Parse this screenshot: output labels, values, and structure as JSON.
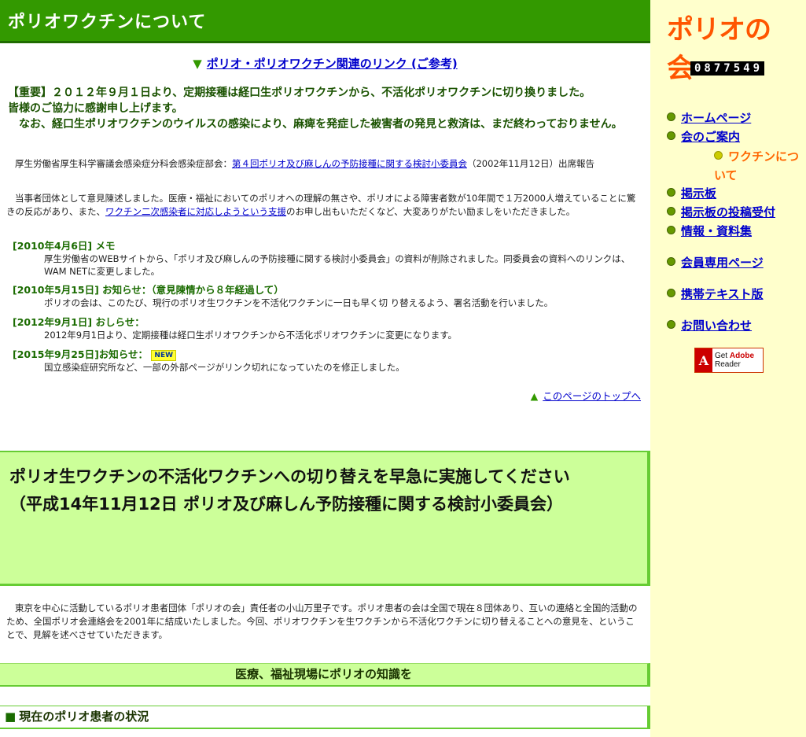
{
  "page_title": "ポリオワクチンについて",
  "ref_link": {
    "arrow": "▼",
    "label": "ポリオ・ポリオワクチン関連のリンク (ご参考)"
  },
  "important": {
    "line1": "【重要】２０１２年９月１日より、定期接種は経口生ポリオワクチンから、不活化ポリオワクチンに切り換りました。",
    "line2": "皆様のご協力に感謝申し上げます。",
    "line3": "　なお、経口生ポリオワクチンのウイルスの感染により、麻痺を発症した被害者の発見と救済は、まだ終わっておりません。"
  },
  "report": {
    "prefix": "厚生労働省厚生科学審議会感染症分科会感染症部会：",
    "link": "第４回ポリオ及び麻しんの予防接種に関する検討小委員会",
    "suffix": "（2002年11月12日）出席報告"
  },
  "statement": {
    "pre": "当事者団体として意見陳述しました。医療・福祉においてのポリオへの理解の無さや、ポリオによる障害者数が10年間で１万2000人増えていることに驚きの反応があり、また、",
    "link": "ワクチン二次感染者に対応しようという支援",
    "post": "のお申し出もいただくなど、大変ありがたい励ましをいただきました。"
  },
  "news": [
    {
      "head": "[2010年4月6日] メモ",
      "body": "厚生労働省のWEBサイトから、「ポリオ及び麻しんの予防接種に関する検討小委員会」の資料が削除されました。同委員会の資料へのリンクは、WAM NETに変更しました。"
    },
    {
      "head": "[2010年5月15日] お知らせ：（意見陳情から８年経過して）",
      "body": "ポリオの会は、このたび、現行のポリオ生ワクチンを不活化ワクチンに一日も早く切 り替えるよう、署名活動を行いました。"
    },
    {
      "head": "[2012年9月1日] おしらせ：",
      "body": "2012年9月1日より、定期接種は経口生ポリオワクチンから不活化ポリオワクチンに変更になります。"
    },
    {
      "head": "[2015年9月25日]お知らせ：",
      "badge": "NEW",
      "body": "国立感染症研究所など、一部の外部ページがリンク切れになっていたのを修正しました。"
    }
  ],
  "to_top": {
    "arrow": "▲",
    "label": "このページのトップへ"
  },
  "banner": {
    "line1": "ポリオ生ワクチンの不活化ワクチンへの切り替えを早急に実施してください",
    "line2": "（平成14年11月12日 ポリオ及び麻しん予防接種に関する検討小委員会）"
  },
  "intro": "東京を中心に活動しているポリオ患者団体「ポリオの会」責任者の小山万里子です。ポリオ患者の会は全国で現在８団体あり、互いの連絡と全国的活動のため、全国ポリオ会連絡会を2001年に結成いたしました。今回、ポリオワクチンを生ワクチンから不活化ワクチンに切り替えることへの意見を、ということで、見解を述べさせていただきます。",
  "section1": "医療、福祉現場にポリオの知識を",
  "section2": {
    "marker": "■",
    "label": "現在のポリオ患者の状況"
  },
  "sidebar": {
    "logo": "ポリオの会",
    "counter": "0877549",
    "nav": [
      "ホームページ",
      "会のご案内",
      "掲示板",
      "掲示板の投稿受付",
      "情報・資料集",
      "会員専用ページ",
      "携帯テキスト版",
      "お問い合わせ"
    ],
    "current": "ワクチンについて",
    "adobe": {
      "mark": "A",
      "get": "Get",
      "brand": "Adobe",
      "product": "Reader"
    }
  },
  "colors": {
    "header_green": "#339900",
    "banner_green": "#ccff99",
    "sidebar_bg": "#ffffcc",
    "link_blue": "#0000cc",
    "current_orange": "#ff6600"
  }
}
